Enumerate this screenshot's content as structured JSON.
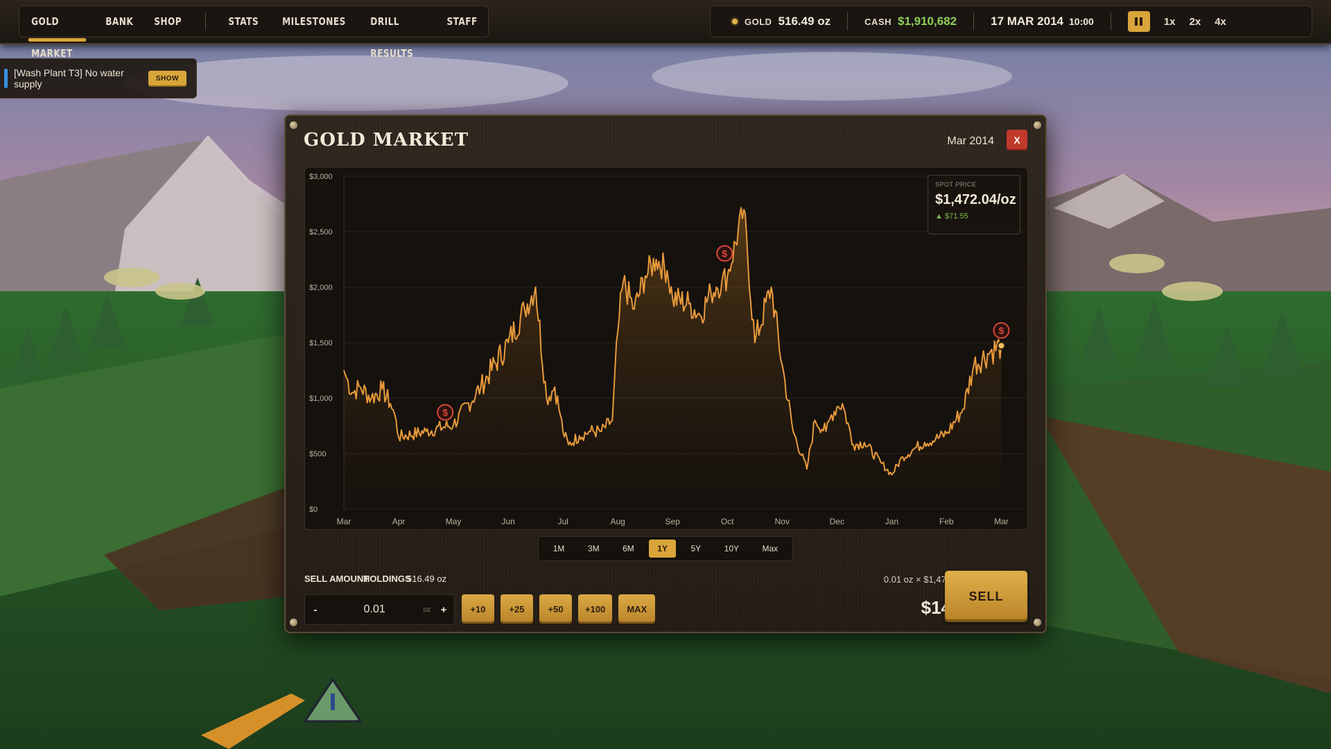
{
  "nav": {
    "items": [
      {
        "id": "gold-market",
        "label": "GOLD MARKET",
        "active": true
      },
      {
        "id": "bank",
        "label": "BANK"
      },
      {
        "id": "shop",
        "label": "SHOP"
      },
      {
        "id": "stats",
        "label": "STATS"
      },
      {
        "id": "milestones",
        "label": "MILESTONES"
      },
      {
        "id": "drill-results",
        "label": "DRILL RESULTS"
      },
      {
        "id": "staff",
        "label": "STAFF"
      }
    ]
  },
  "status": {
    "gold_label": "GOLD",
    "gold_value": "516.49 oz",
    "cash_label": "CASH",
    "cash_value": "$1,910,682",
    "date": "17 MAR 2014",
    "time": "10:00",
    "speeds": [
      "1x",
      "2x",
      "4x"
    ]
  },
  "notification": {
    "text": "[Wash Plant T3] No water supply",
    "button": "SHOW",
    "accent": "#3b8fe0"
  },
  "panel": {
    "title": "GOLD MARKET",
    "date": "Mar 2014",
    "close": "X",
    "spot_label": "SPOT PRICE",
    "spot_price": "$1,472.04/oz",
    "spot_change": "$71.55",
    "ranges": [
      {
        "label": "1M"
      },
      {
        "label": "3M"
      },
      {
        "label": "6M"
      },
      {
        "label": "1Y",
        "active": true
      },
      {
        "label": "5Y"
      },
      {
        "label": "10Y"
      },
      {
        "label": "Max"
      }
    ],
    "sell_amount_label": "SELL AMOUNT",
    "holdings_label": "HOLDINGS",
    "holdings_value": "516.49 oz",
    "amount_value": "0.01",
    "amount_unit": "oz",
    "minus": "-",
    "plus": "+",
    "increments": [
      "+10",
      "+25",
      "+50",
      "+100",
      "MAX"
    ],
    "calc": "0.01 oz × $1,472",
    "total": "$14",
    "sell_button": "SELL"
  },
  "colors": {
    "accent": "#d9a53a",
    "line": "#e89a3c",
    "marker": "#d9473a",
    "cash": "#8fcf5a",
    "change_up": "#7dbb4f"
  },
  "chart_data": {
    "type": "area",
    "y_ticks": [
      "$0",
      "$500",
      "$1,000",
      "$1,500",
      "$2,000",
      "$2,500",
      "$3,000"
    ],
    "ylim": [
      0,
      3000
    ],
    "x_ticks": [
      "Mar",
      "Apr",
      "May",
      "Jun",
      "Jul",
      "Aug",
      "Sep",
      "Oct",
      "Nov",
      "Dec",
      "Jan",
      "Feb",
      "Mar"
    ],
    "x": [
      0,
      0.05,
      0.15,
      0.3,
      0.5,
      0.7,
      0.85,
      0.93,
      1.0,
      1.5,
      2.0,
      2.5,
      3.0,
      3.3,
      3.5,
      3.7,
      3.85,
      3.95,
      4.0,
      4.1,
      4.3,
      4.5,
      4.7,
      4.9,
      5.0,
      5.1,
      5.3,
      5.5,
      5.7,
      5.9,
      6.0,
      6.3,
      6.5,
      6.7,
      6.8,
      6.9,
      7.0,
      7.3,
      7.5,
      7.8,
      8.0,
      8.2,
      8.45,
      8.6,
      8.8,
      8.9,
      9.0,
      9.1,
      9.3,
      9.5,
      9.8,
      10.0,
      10.2,
      10.4,
      10.6,
      10.8,
      11.0,
      11.3,
      11.5,
      11.8,
      12.0
    ],
    "y": [
      1250,
      1180,
      1050,
      1100,
      1000,
      1080,
      950,
      850,
      650,
      700,
      760,
      1100,
      1500,
      1800,
      2000,
      1000,
      1100,
      850,
      700,
      580,
      660,
      700,
      700,
      800,
      1600,
      2050,
      1800,
      2100,
      2250,
      2150,
      1900,
      1850,
      1750,
      1950,
      2000,
      2050,
      2100,
      2700,
      1500,
      2000,
      1300,
      700,
      360,
      800,
      700,
      850,
      920,
      950,
      580,
      600,
      420,
      310,
      470,
      540,
      600,
      630,
      680,
      900,
      1300,
      1420,
      1472
    ],
    "sell_markers_x": [
      1.85,
      6.95,
      12.45
    ]
  }
}
